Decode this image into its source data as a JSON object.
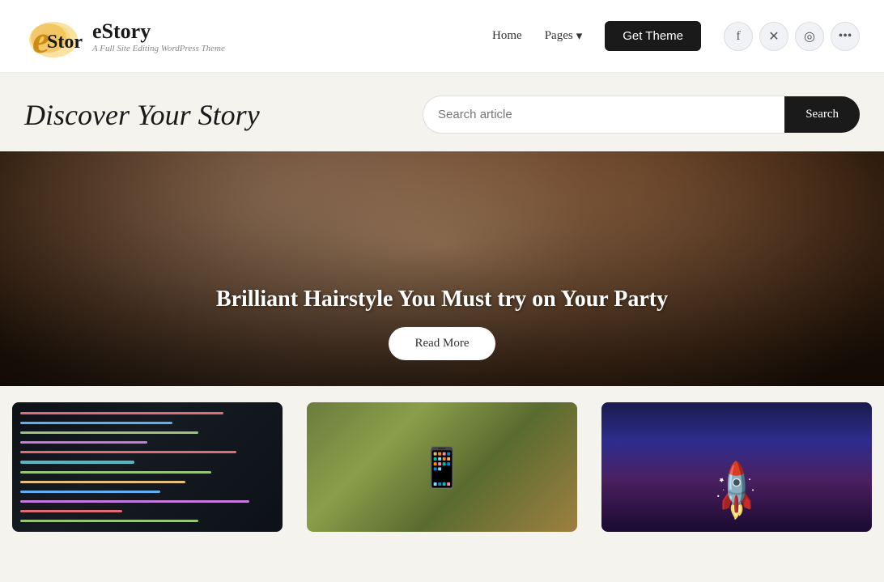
{
  "header": {
    "logo_title": "eStory",
    "logo_subtitle": "A Full Site Editing WordPress Theme",
    "nav": {
      "home_label": "Home",
      "pages_label": "Pages",
      "get_theme_label": "Get Theme"
    },
    "social": {
      "facebook": "f",
      "twitter": "𝕏",
      "instagram": "◎",
      "more": "…"
    }
  },
  "hero": {
    "discover_title": "Discover Your Story",
    "search_placeholder": "Search article",
    "search_button_label": "Search"
  },
  "featured": {
    "title": "Brilliant Hairstyle You Must try on Your Party",
    "read_more_label": "Read More"
  },
  "cards": [
    {
      "type": "code",
      "alt": "Code screenshot"
    },
    {
      "type": "phone",
      "alt": "Person holding phone"
    },
    {
      "type": "rocket",
      "alt": "Rocket launching"
    }
  ]
}
